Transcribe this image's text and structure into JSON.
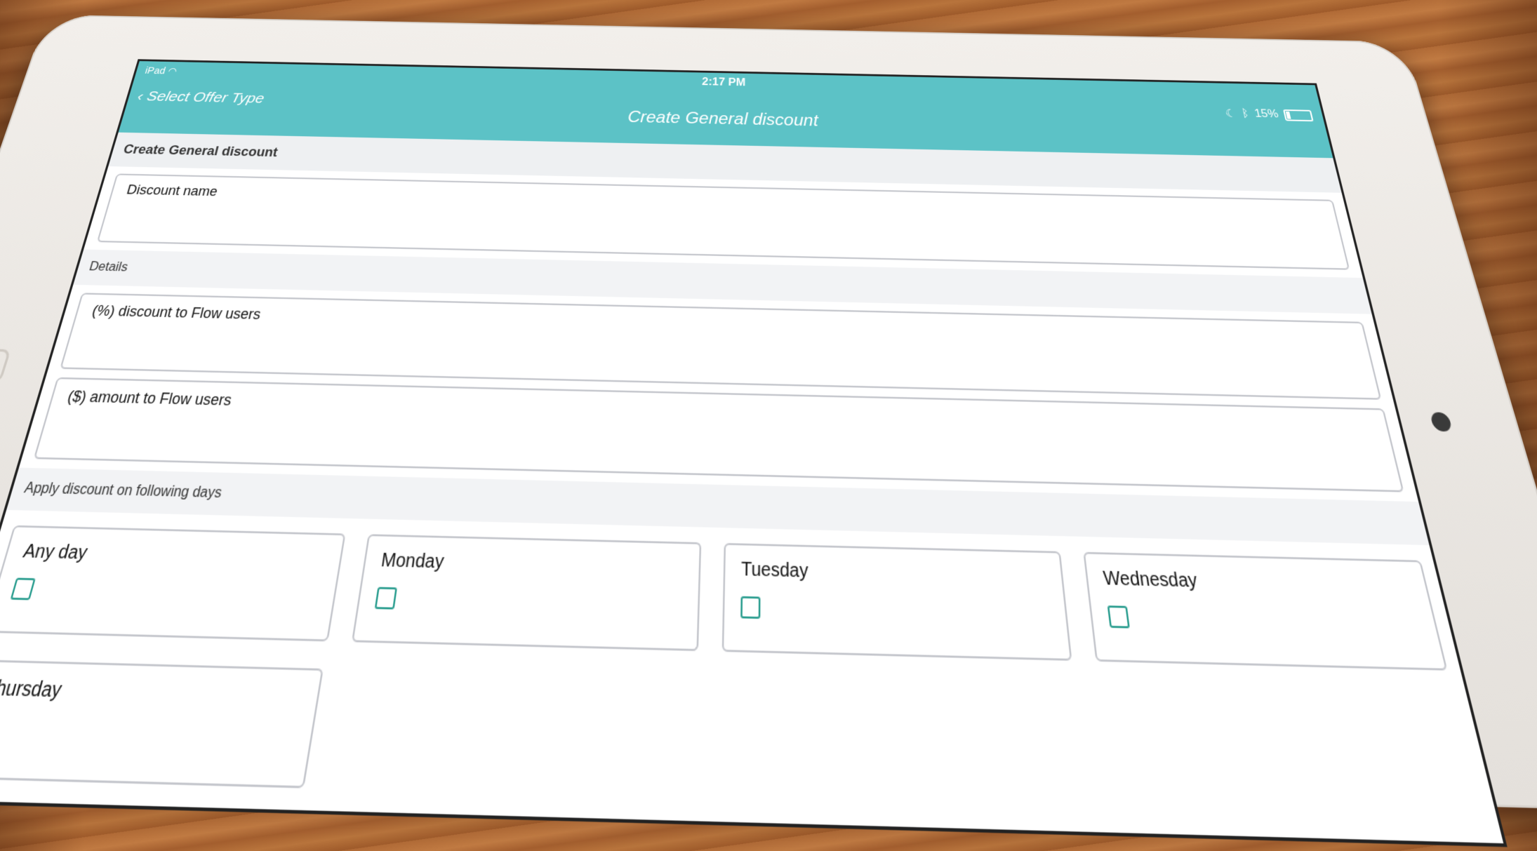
{
  "status_bar": {
    "device": "iPad",
    "time": "2:17 PM",
    "battery": "15%"
  },
  "navbar": {
    "back_label": "Select Offer Type",
    "title": "Create General discount"
  },
  "form": {
    "section_title": "Create General discount",
    "discount_name_label": "Discount name",
    "details_header": "Details",
    "percent_label": "(%) discount to Flow users",
    "amount_label": "($) amount to Flow users",
    "days_header": "Apply discount on following days",
    "days": [
      "Any day",
      "Monday",
      "Tuesday",
      "Wednesday",
      "Thursday"
    ]
  },
  "colors": {
    "accent": "#5cc2c6",
    "checkbox": "#2a9d8f"
  },
  "icons": {
    "back": "chevron-left-icon",
    "wifi": "wifi-icon",
    "moon": "moon-icon",
    "bluetooth": "bluetooth-icon",
    "battery": "battery-icon"
  }
}
